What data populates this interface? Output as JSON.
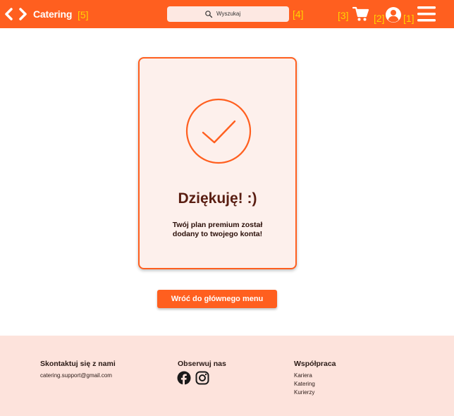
{
  "header": {
    "brand": "Catering",
    "search_placeholder": "Wyszukaj",
    "markers": {
      "brand": "[5]",
      "search": "[4]",
      "cart": "[3]",
      "account": "[2]",
      "menu": "[1]"
    },
    "icons": {
      "back": "chevron-left-icon",
      "forward": "chevron-right-icon",
      "search": "search-icon",
      "cart": "cart-icon",
      "account": "user-circle-icon",
      "menu": "hamburger-menu-icon"
    }
  },
  "confirmation": {
    "heading": "Dziękuję! :)",
    "message_line1": "Twój plan premium został",
    "message_line2": "dodany to twojego konta!",
    "icon": "check-circle-icon"
  },
  "back_button_label": "Wróć do głównego menu",
  "footer": {
    "contact": {
      "heading": "Skontaktuj się z nami",
      "email": "catering.support@gmail.com"
    },
    "social": {
      "heading": "Obserwuj nas",
      "icons": [
        "facebook-icon",
        "instagram-icon"
      ]
    },
    "cooperation": {
      "heading": "Współpraca",
      "links": [
        "Kariera",
        "Katering",
        "Kurierzy"
      ]
    }
  },
  "colors": {
    "accent": "#ff5f1f",
    "card_background": "#fdf0ec",
    "footer_background": "#fde3dc",
    "marker": "#ffd400"
  }
}
